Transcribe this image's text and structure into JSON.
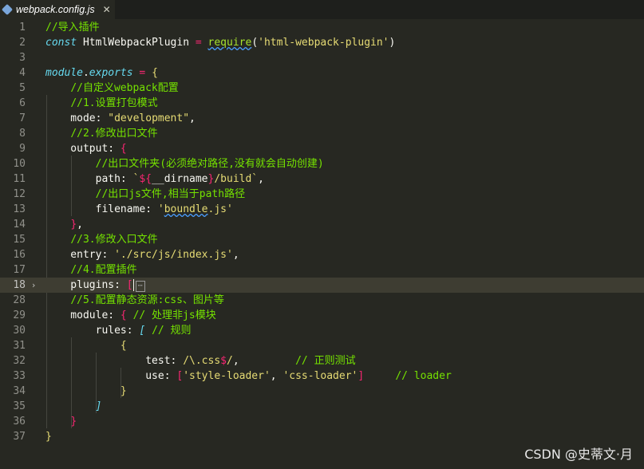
{
  "tab": {
    "title": "webpack.config.js",
    "close": "✕"
  },
  "watermark": "CSDN @史蒂文·月",
  "colors": {
    "background": "#272822",
    "current_line": "#3e3d32"
  },
  "lines": [
    {
      "n": "1",
      "tokens": [
        [
          "c",
          "//导入插件"
        ]
      ]
    },
    {
      "n": "2",
      "tokens": [
        [
          "k",
          "const"
        ],
        [
          "p",
          " HtmlWebpackPlugin "
        ],
        [
          "o",
          "="
        ],
        [
          "p",
          " "
        ],
        [
          "f squig",
          "require"
        ],
        [
          "p",
          "("
        ],
        [
          "s",
          "'html-webpack-plugin'"
        ],
        [
          "p",
          ")"
        ]
      ]
    },
    {
      "n": "3",
      "tokens": []
    },
    {
      "n": "4",
      "tokens": [
        [
          "k",
          "module"
        ],
        [
          "p",
          "."
        ],
        [
          "k",
          "exports"
        ],
        [
          "p",
          " "
        ],
        [
          "o",
          "="
        ],
        [
          "p",
          " "
        ],
        [
          "b",
          "{"
        ]
      ]
    },
    {
      "n": "5",
      "tokens": [
        [
          "p",
          "    "
        ],
        [
          "c",
          "//自定义webpack配置"
        ]
      ]
    },
    {
      "n": "6",
      "tokens": [
        [
          "p",
          "    "
        ],
        [
          "c",
          "//1.设置打包模式"
        ]
      ]
    },
    {
      "n": "7",
      "tokens": [
        [
          "p",
          "    mode: "
        ],
        [
          "s",
          "\"development\""
        ],
        [
          "p",
          ","
        ]
      ]
    },
    {
      "n": "8",
      "tokens": [
        [
          "p",
          "    "
        ],
        [
          "c",
          "//2.修改出口文件"
        ]
      ]
    },
    {
      "n": "9",
      "tokens": [
        [
          "p",
          "    output: "
        ],
        [
          "o",
          "{"
        ]
      ]
    },
    {
      "n": "10",
      "tokens": [
        [
          "p",
          "        "
        ],
        [
          "c",
          "//出口文件夹(必须绝对路径,没有就会自动创建)"
        ]
      ]
    },
    {
      "n": "11",
      "tokens": [
        [
          "p",
          "        path: "
        ],
        [
          "s",
          "`"
        ],
        [
          "o",
          "${"
        ],
        [
          "p",
          "__dirname"
        ],
        [
          "o",
          "}"
        ],
        [
          "s",
          "/build`"
        ],
        [
          "p",
          ","
        ]
      ]
    },
    {
      "n": "12",
      "tokens": [
        [
          "p",
          "        "
        ],
        [
          "c",
          "//出口js文件,相当于path路径"
        ]
      ]
    },
    {
      "n": "13",
      "tokens": [
        [
          "p",
          "        filename: "
        ],
        [
          "s",
          "'"
        ],
        [
          "s squig",
          "boundle"
        ],
        [
          "s",
          ".js'"
        ]
      ]
    },
    {
      "n": "14",
      "tokens": [
        [
          "p",
          "    "
        ],
        [
          "o",
          "}"
        ],
        [
          "p",
          ","
        ]
      ]
    },
    {
      "n": "15",
      "tokens": [
        [
          "p",
          "    "
        ],
        [
          "c",
          "//3.修改入口文件"
        ]
      ]
    },
    {
      "n": "16",
      "tokens": [
        [
          "p",
          "    entry: "
        ],
        [
          "s",
          "'./src/js/index.js'"
        ],
        [
          "p",
          ","
        ]
      ]
    },
    {
      "n": "17",
      "tokens": [
        [
          "p",
          "    "
        ],
        [
          "c",
          "//4.配置插件"
        ]
      ]
    },
    {
      "n": "18",
      "tokens": [
        [
          "p",
          "    plugins: "
        ],
        [
          "o",
          "["
        ],
        [
          "cursor",
          ""
        ],
        [
          "fold",
          "⋯"
        ]
      ],
      "current": true,
      "folded": true
    },
    {
      "n": "28",
      "tokens": [
        [
          "p",
          "    "
        ],
        [
          "c",
          "//5.配置静态资源:css、图片等"
        ]
      ]
    },
    {
      "n": "29",
      "tokens": [
        [
          "p",
          "    module: "
        ],
        [
          "o",
          "{"
        ],
        [
          "p",
          " "
        ],
        [
          "c",
          "// 处理非js模块"
        ]
      ]
    },
    {
      "n": "30",
      "tokens": [
        [
          "p",
          "        rules: "
        ],
        [
          "k",
          "["
        ],
        [
          "p",
          " "
        ],
        [
          "c",
          "// 规则"
        ]
      ]
    },
    {
      "n": "31",
      "tokens": [
        [
          "p",
          "            "
        ],
        [
          "b",
          "{"
        ]
      ]
    },
    {
      "n": "32",
      "tokens": [
        [
          "p",
          "                test: "
        ],
        [
          "s",
          "/\\.css"
        ],
        [
          "o",
          "$"
        ],
        [
          "s",
          "/"
        ],
        [
          "p",
          ",         "
        ],
        [
          "c",
          "// 正则测试"
        ]
      ]
    },
    {
      "n": "33",
      "tokens": [
        [
          "p",
          "                use: "
        ],
        [
          "o",
          "["
        ],
        [
          "s",
          "'style-loader'"
        ],
        [
          "p",
          ", "
        ],
        [
          "s",
          "'css-loader'"
        ],
        [
          "o",
          "]"
        ],
        [
          "p",
          "     "
        ],
        [
          "c",
          "// loader"
        ]
      ]
    },
    {
      "n": "34",
      "tokens": [
        [
          "p",
          "            "
        ],
        [
          "b",
          "}"
        ]
      ]
    },
    {
      "n": "35",
      "tokens": [
        [
          "p",
          "        "
        ],
        [
          "k",
          "]"
        ]
      ]
    },
    {
      "n": "36",
      "tokens": [
        [
          "p",
          "    "
        ],
        [
          "o",
          "}"
        ]
      ]
    },
    {
      "n": "37",
      "tokens": [
        [
          "b",
          "}"
        ]
      ]
    }
  ]
}
